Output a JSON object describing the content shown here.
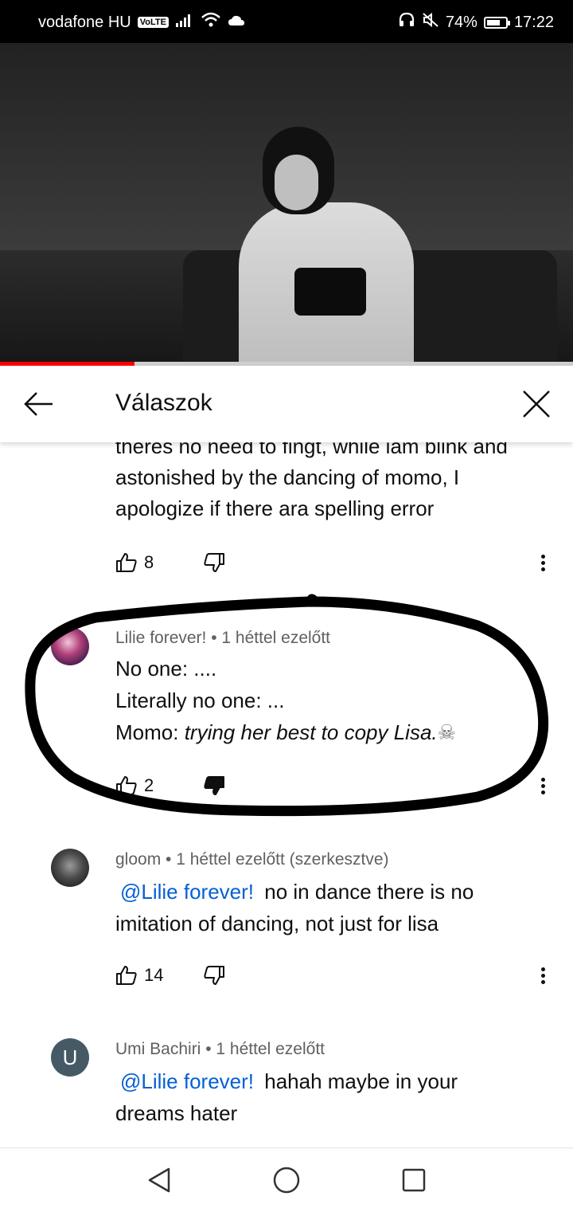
{
  "status_bar": {
    "carrier": "vodafone HU",
    "volte_badge": "VoLTE",
    "battery": "74%",
    "time": "17:22",
    "battery_level": 0.74
  },
  "video": {
    "progress": 0.235,
    "played_color": "#ff0000"
  },
  "header": {
    "title": "Válaszok"
  },
  "cut_comment": {
    "lines": [
      "theres no need to fingt, while iam blink and",
      "astonished by the dancing of momo, I",
      "apologize if there ara spelling error"
    ],
    "likes": "8"
  },
  "comments": [
    {
      "author": "Lilie forever!",
      "time": "1 héttel ezelőtt",
      "lines": [
        "No one: ....",
        "Literally no one: ..."
      ],
      "line3_prefix": "Momo: ",
      "line3_italic": "trying her best to copy Lisa.",
      "emoji": "☠",
      "likes": "2",
      "disliked": true
    },
    {
      "author": "gloom",
      "time": "1 héttel ezelőtt (szerkesztve)",
      "mention": "@Lilie forever!",
      "text_first": "no in dance there is no",
      "text_second": "imitation of dancing, not just for lisa",
      "likes": "14"
    },
    {
      "author": "Umi Bachiri",
      "time": "1 héttel ezelőtt",
      "avatar_letter": "U",
      "avatar_color": "#455a64",
      "mention": "@Lilie forever!",
      "text_first": "hahah maybe in your",
      "text_second": "dreams hater"
    }
  ],
  "separator": " • "
}
